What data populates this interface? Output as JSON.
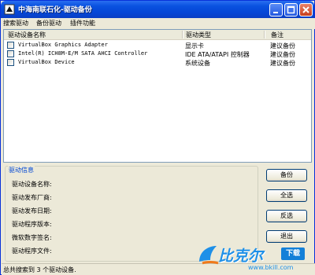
{
  "window": {
    "title": "中海南联石化-驱动备份"
  },
  "menu": [
    "搜索驱动",
    "备份驱动",
    "插件功能"
  ],
  "table": {
    "columns": [
      "驱动设备名称",
      "驱动类型",
      "备注"
    ],
    "rows": [
      {
        "name": "VirtualBox Graphics Adapter",
        "type": "显示卡",
        "note": "建议备份"
      },
      {
        "name": "Intel(R) ICH8M-E/M SATA AHCI Controller",
        "type": "IDE ATA/ATAPI 控制器",
        "note": "建议备份"
      },
      {
        "name": "VirtualBox Device",
        "type": "系统设备",
        "note": "建议备份"
      }
    ]
  },
  "info": {
    "title": "驱动信息",
    "labels": [
      "驱动设备名称:",
      "驱动发布厂商:",
      "驱动发布日期:",
      "驱动程序版本:",
      "微软数字签名:",
      "驱动程序文件:"
    ]
  },
  "buttons": [
    "备份",
    "全选",
    "反选",
    "退出"
  ],
  "status": "总共搜索到 3 个驱动设备.",
  "watermark": {
    "brand": "比克尔",
    "badge": "下载",
    "url": "www.bkill.com"
  }
}
